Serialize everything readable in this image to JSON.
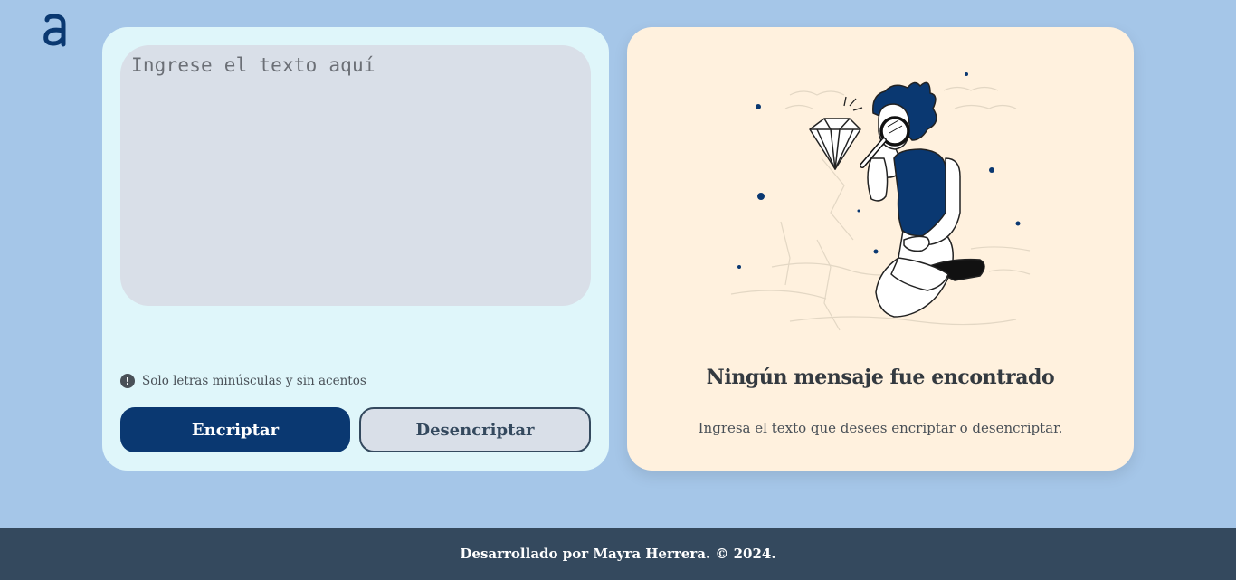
{
  "logo": {
    "icon": "alura-logo-icon",
    "color": "#0a3871"
  },
  "input": {
    "placeholder": "Ingrese el texto aquí"
  },
  "hint": {
    "icon": "info-icon",
    "text": "Solo letras minúsculas y sin acentos"
  },
  "buttons": {
    "encrypt_label": "Encriptar",
    "decrypt_label": "Desencriptar"
  },
  "output": {
    "illustration": "person-with-magnifier-illustration",
    "title": "Ningún mensaje fue encontrado",
    "description": "Ingresa el texto que desees encriptar o desencriptar."
  },
  "footer": {
    "text": "Desarrollado por Mayra Herrera. © 2024."
  },
  "colors": {
    "background": "#a5c6e8",
    "primary": "#0a3871",
    "left_card": "#dff6fa",
    "right_card": "#fff1de",
    "footer": "#34495e"
  }
}
